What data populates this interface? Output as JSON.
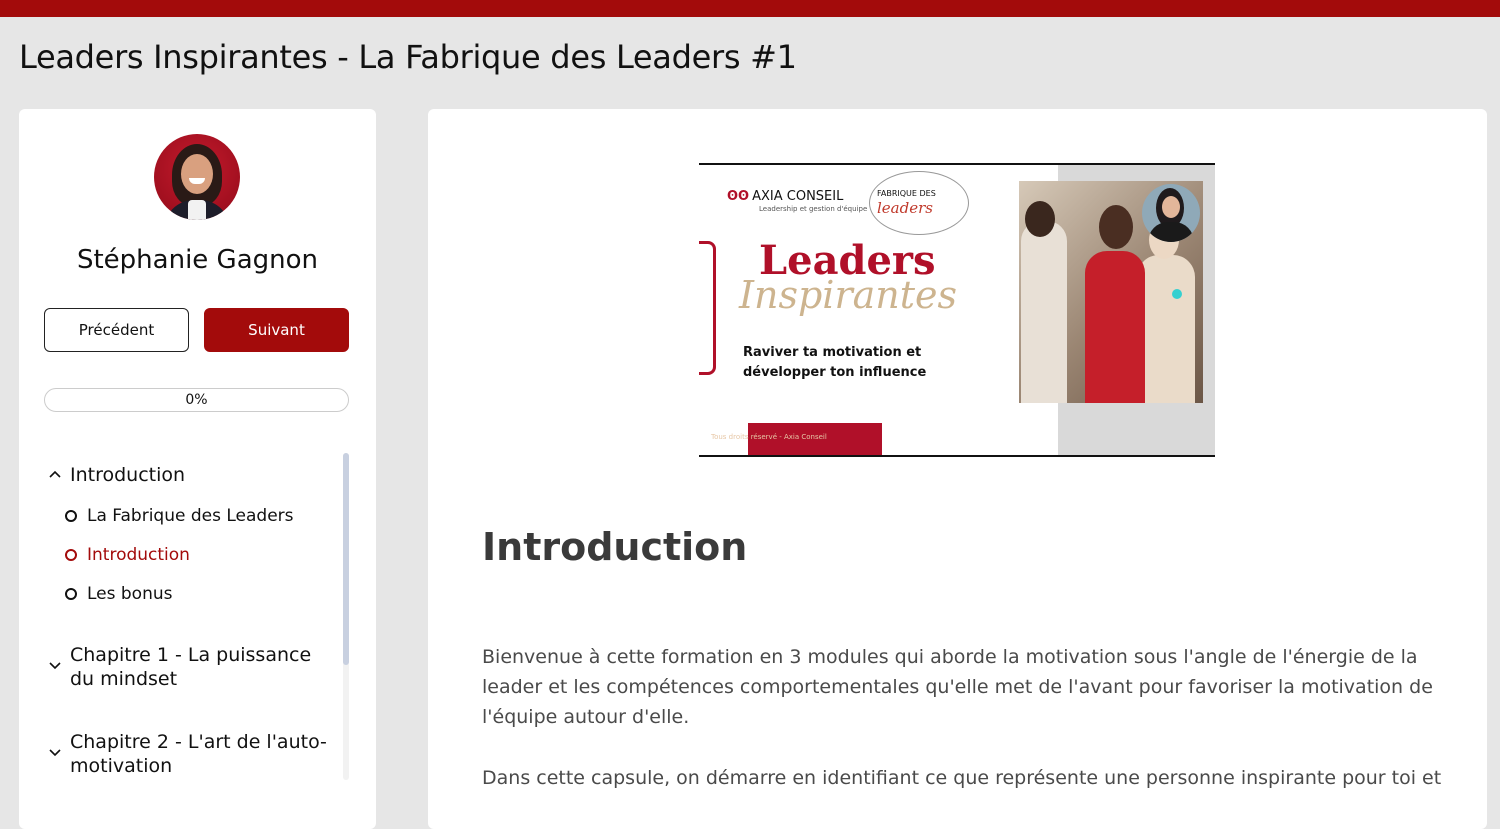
{
  "page": {
    "title": "Leaders Inspirantes - La Fabrique des Leaders #1"
  },
  "colors": {
    "brand": "#a30b0b",
    "slide_accent": "#b01029",
    "background": "#e6e6e6"
  },
  "sidebar": {
    "instructor_name": "Stéphanie Gagnon",
    "prev_label": "Précédent",
    "next_label": "Suivant",
    "progress_label": "0%",
    "progress_fraction": 0,
    "sections": [
      {
        "title": "Introduction",
        "expanded": true,
        "lessons": [
          {
            "title": "La Fabrique des Leaders",
            "active": false
          },
          {
            "title": "Introduction",
            "active": true
          },
          {
            "title": "Les bonus",
            "active": false
          }
        ]
      },
      {
        "title": "Chapitre 1 - La puissance du mindset",
        "expanded": false
      },
      {
        "title": "Chapitre 2 - L'art de l'auto-motivation",
        "expanded": false
      }
    ]
  },
  "slide": {
    "logo": "AXIA CONSEIL",
    "logo_sub": "Leadership et gestion d'équipe",
    "fabrique_top": "FABRIQUE DES",
    "fabrique_bottom": "leaders",
    "title": "Leaders",
    "script": "Inspirantes",
    "subtitle": "Raviver ta motivation et développer ton influence",
    "footer": "Tous droits réservé - Axia Conseil"
  },
  "content": {
    "heading": "Introduction",
    "paragraph1": "Bienvenue à cette formation en 3 modules qui aborde la motivation sous l'angle de l'énergie de la leader et les compétences comportementales qu'elle met de l'avant pour favoriser la motivation de l'équipe autour d'elle.",
    "paragraph2": "Dans cette capsule, on démarre en identifiant ce que représente une personne inspirante pour toi et"
  }
}
